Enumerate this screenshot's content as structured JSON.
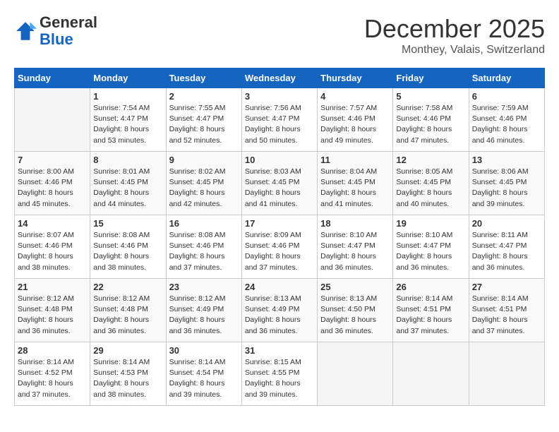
{
  "header": {
    "logo_general": "General",
    "logo_blue": "Blue",
    "title": "December 2025",
    "subtitle": "Monthey, Valais, Switzerland"
  },
  "calendar": {
    "days_of_week": [
      "Sunday",
      "Monday",
      "Tuesday",
      "Wednesday",
      "Thursday",
      "Friday",
      "Saturday"
    ],
    "weeks": [
      [
        {
          "day": "",
          "sunrise": "",
          "sunset": "",
          "daylight": "",
          "empty": true
        },
        {
          "day": "1",
          "sunrise": "Sunrise: 7:54 AM",
          "sunset": "Sunset: 4:47 PM",
          "daylight": "Daylight: 8 hours and 53 minutes."
        },
        {
          "day": "2",
          "sunrise": "Sunrise: 7:55 AM",
          "sunset": "Sunset: 4:47 PM",
          "daylight": "Daylight: 8 hours and 52 minutes."
        },
        {
          "day": "3",
          "sunrise": "Sunrise: 7:56 AM",
          "sunset": "Sunset: 4:47 PM",
          "daylight": "Daylight: 8 hours and 50 minutes."
        },
        {
          "day": "4",
          "sunrise": "Sunrise: 7:57 AM",
          "sunset": "Sunset: 4:46 PM",
          "daylight": "Daylight: 8 hours and 49 minutes."
        },
        {
          "day": "5",
          "sunrise": "Sunrise: 7:58 AM",
          "sunset": "Sunset: 4:46 PM",
          "daylight": "Daylight: 8 hours and 47 minutes."
        },
        {
          "day": "6",
          "sunrise": "Sunrise: 7:59 AM",
          "sunset": "Sunset: 4:46 PM",
          "daylight": "Daylight: 8 hours and 46 minutes."
        }
      ],
      [
        {
          "day": "7",
          "sunrise": "Sunrise: 8:00 AM",
          "sunset": "Sunset: 4:46 PM",
          "daylight": "Daylight: 8 hours and 45 minutes."
        },
        {
          "day": "8",
          "sunrise": "Sunrise: 8:01 AM",
          "sunset": "Sunset: 4:45 PM",
          "daylight": "Daylight: 8 hours and 44 minutes."
        },
        {
          "day": "9",
          "sunrise": "Sunrise: 8:02 AM",
          "sunset": "Sunset: 4:45 PM",
          "daylight": "Daylight: 8 hours and 42 minutes."
        },
        {
          "day": "10",
          "sunrise": "Sunrise: 8:03 AM",
          "sunset": "Sunset: 4:45 PM",
          "daylight": "Daylight: 8 hours and 41 minutes."
        },
        {
          "day": "11",
          "sunrise": "Sunrise: 8:04 AM",
          "sunset": "Sunset: 4:45 PM",
          "daylight": "Daylight: 8 hours and 41 minutes."
        },
        {
          "day": "12",
          "sunrise": "Sunrise: 8:05 AM",
          "sunset": "Sunset: 4:45 PM",
          "daylight": "Daylight: 8 hours and 40 minutes."
        },
        {
          "day": "13",
          "sunrise": "Sunrise: 8:06 AM",
          "sunset": "Sunset: 4:45 PM",
          "daylight": "Daylight: 8 hours and 39 minutes."
        }
      ],
      [
        {
          "day": "14",
          "sunrise": "Sunrise: 8:07 AM",
          "sunset": "Sunset: 4:46 PM",
          "daylight": "Daylight: 8 hours and 38 minutes."
        },
        {
          "day": "15",
          "sunrise": "Sunrise: 8:08 AM",
          "sunset": "Sunset: 4:46 PM",
          "daylight": "Daylight: 8 hours and 38 minutes."
        },
        {
          "day": "16",
          "sunrise": "Sunrise: 8:08 AM",
          "sunset": "Sunset: 4:46 PM",
          "daylight": "Daylight: 8 hours and 37 minutes."
        },
        {
          "day": "17",
          "sunrise": "Sunrise: 8:09 AM",
          "sunset": "Sunset: 4:46 PM",
          "daylight": "Daylight: 8 hours and 37 minutes."
        },
        {
          "day": "18",
          "sunrise": "Sunrise: 8:10 AM",
          "sunset": "Sunset: 4:47 PM",
          "daylight": "Daylight: 8 hours and 36 minutes."
        },
        {
          "day": "19",
          "sunrise": "Sunrise: 8:10 AM",
          "sunset": "Sunset: 4:47 PM",
          "daylight": "Daylight: 8 hours and 36 minutes."
        },
        {
          "day": "20",
          "sunrise": "Sunrise: 8:11 AM",
          "sunset": "Sunset: 4:47 PM",
          "daylight": "Daylight: 8 hours and 36 minutes."
        }
      ],
      [
        {
          "day": "21",
          "sunrise": "Sunrise: 8:12 AM",
          "sunset": "Sunset: 4:48 PM",
          "daylight": "Daylight: 8 hours and 36 minutes."
        },
        {
          "day": "22",
          "sunrise": "Sunrise: 8:12 AM",
          "sunset": "Sunset: 4:48 PM",
          "daylight": "Daylight: 8 hours and 36 minutes."
        },
        {
          "day": "23",
          "sunrise": "Sunrise: 8:12 AM",
          "sunset": "Sunset: 4:49 PM",
          "daylight": "Daylight: 8 hours and 36 minutes."
        },
        {
          "day": "24",
          "sunrise": "Sunrise: 8:13 AM",
          "sunset": "Sunset: 4:49 PM",
          "daylight": "Daylight: 8 hours and 36 minutes."
        },
        {
          "day": "25",
          "sunrise": "Sunrise: 8:13 AM",
          "sunset": "Sunset: 4:50 PM",
          "daylight": "Daylight: 8 hours and 36 minutes."
        },
        {
          "day": "26",
          "sunrise": "Sunrise: 8:14 AM",
          "sunset": "Sunset: 4:51 PM",
          "daylight": "Daylight: 8 hours and 37 minutes."
        },
        {
          "day": "27",
          "sunrise": "Sunrise: 8:14 AM",
          "sunset": "Sunset: 4:51 PM",
          "daylight": "Daylight: 8 hours and 37 minutes."
        }
      ],
      [
        {
          "day": "28",
          "sunrise": "Sunrise: 8:14 AM",
          "sunset": "Sunset: 4:52 PM",
          "daylight": "Daylight: 8 hours and 37 minutes."
        },
        {
          "day": "29",
          "sunrise": "Sunrise: 8:14 AM",
          "sunset": "Sunset: 4:53 PM",
          "daylight": "Daylight: 8 hours and 38 minutes."
        },
        {
          "day": "30",
          "sunrise": "Sunrise: 8:14 AM",
          "sunset": "Sunset: 4:54 PM",
          "daylight": "Daylight: 8 hours and 39 minutes."
        },
        {
          "day": "31",
          "sunrise": "Sunrise: 8:15 AM",
          "sunset": "Sunset: 4:55 PM",
          "daylight": "Daylight: 8 hours and 39 minutes."
        },
        {
          "day": "",
          "sunrise": "",
          "sunset": "",
          "daylight": "",
          "empty": true
        },
        {
          "day": "",
          "sunrise": "",
          "sunset": "",
          "daylight": "",
          "empty": true
        },
        {
          "day": "",
          "sunrise": "",
          "sunset": "",
          "daylight": "",
          "empty": true
        }
      ]
    ]
  }
}
